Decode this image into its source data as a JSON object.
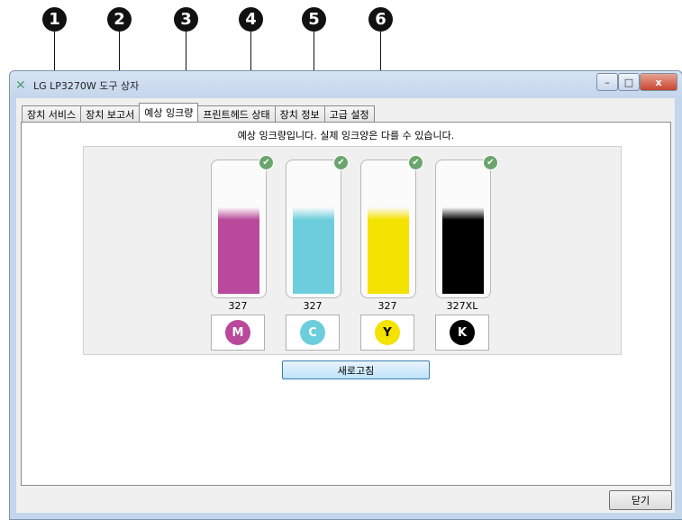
{
  "callouts": [
    "1",
    "2",
    "3",
    "4",
    "5",
    "6"
  ],
  "window": {
    "title": "LG LP3270W 도구 상자",
    "minimize_glyph": "–",
    "maximize_glyph": "□",
    "close_glyph": "x"
  },
  "tabs": [
    {
      "label": "장치 서비스"
    },
    {
      "label": "장치 보고서"
    },
    {
      "label": "예상 잉크량",
      "active": true
    },
    {
      "label": "프린트헤드 상태"
    },
    {
      "label": "장치 정보"
    },
    {
      "label": "고급 설정"
    }
  ],
  "panel": {
    "message": "예상 잉크량입니다. 실제 잉크양은 다를 수 있습니다.",
    "cartridges": [
      {
        "number": "327",
        "letter": "M",
        "color": "#b9499a",
        "level": 0.67,
        "check": "✔"
      },
      {
        "number": "327",
        "letter": "C",
        "color": "#6ccedd",
        "level": 0.67,
        "check": "✔"
      },
      {
        "number": "327",
        "letter": "Y",
        "color": "#f4e200",
        "level": 0.67,
        "check": "✔"
      },
      {
        "number": "327XL",
        "letter": "K",
        "color": "#000000",
        "level": 0.67,
        "check": "✔"
      }
    ],
    "refresh_label": "새로고침"
  },
  "close_label": "닫기"
}
